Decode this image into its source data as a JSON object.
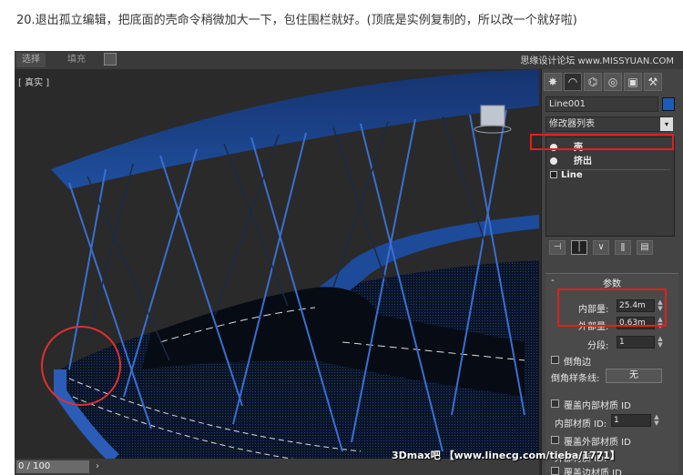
{
  "caption": "20.退出孤立编辑，把底面的壳命令稍微加大一下，包住围栏就好。(顶底是实例复制的，所以改一个就好啦)",
  "toolbar": {
    "tab1": "选择",
    "tab2": "填充",
    "watermark_top": "思缘设计论坛 www.MISSYUAN.COM"
  },
  "viewport": {
    "label": "[ 真实 ]",
    "frame_counter": "0 / 100",
    "frame_arrow": "›"
  },
  "panel": {
    "icons": [
      "sun",
      "arc",
      "hierarchy",
      "motion",
      "display",
      "hammer"
    ],
    "object_name": "Line001",
    "object_color": "#1b5cb8",
    "modifier_list": "修改器列表",
    "modifier_list_arrow": "▾",
    "stack": [
      {
        "label": "壳",
        "kind": "modifier"
      },
      {
        "label": "挤出",
        "kind": "modifier"
      },
      {
        "label": "Line",
        "kind": "base"
      }
    ],
    "rollout": {
      "minus": "-",
      "title": "参数",
      "inner_label": "内部量:",
      "inner_value": "25.4m",
      "outer_label": "外部量:",
      "outer_value": "0.63m",
      "segments_label": "分段:",
      "segments_value": "1",
      "bevel_edges": "倒角边",
      "bevel_spline": "倒角样条线:",
      "none_button": "无",
      "override_inner": "覆盖内部材质 ID",
      "inner_id_label": "内部材质 ID:",
      "inner_id_value": "1",
      "override_outer": "覆盖外部材质 ID",
      "outer_id_label": "外部材质 ID:",
      "override_edge": "覆盖边材质 ID"
    }
  },
  "watermark_bottom": "3Dmax吧 【www.linecg.com/tieba/1771】",
  "colors": {
    "highlight": "#e02020",
    "shell_blue": "#1f4f9e",
    "fence_blue": "#3a6fd0"
  }
}
